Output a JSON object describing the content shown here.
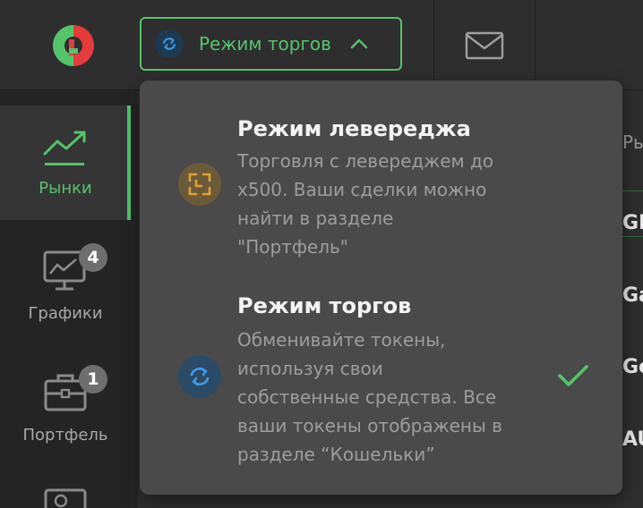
{
  "header": {
    "mode_button_label": "Режим торгов"
  },
  "sidebar": {
    "items": [
      {
        "label": "Рынки",
        "icon": "chart-trend-icon",
        "active": true
      },
      {
        "label": "Графики",
        "icon": "monitor-chart-icon",
        "badge": "4"
      },
      {
        "label": "Портфель",
        "icon": "briefcase-icon",
        "badge": "1"
      }
    ]
  },
  "background_list": {
    "header_fragment": "Ры",
    "rows": [
      "GI",
      "Ga",
      "Ge",
      "AU"
    ]
  },
  "dropdown": {
    "options": [
      {
        "title": "Режим левереджа",
        "description_lines": [
          "Торговля с левереджем до",
          "x500. Ваши сделки можно",
          "найти в разделе",
          "\"Портфель\""
        ],
        "icon": "leverage-frame-icon",
        "selected": false
      },
      {
        "title": "Режим торгов",
        "description_lines": [
          "Обменивайте токены,",
          "используя свои",
          "собственные средства. Все",
          "ваши токены отображены в",
          "разделе “Кошельки”"
        ],
        "icon": "swap-arrows-icon",
        "selected": true
      }
    ]
  },
  "colors": {
    "accent": "#56c46b",
    "background": "#2b2b2b",
    "dropdown_bg": "#4a4a4a",
    "leverage_icon": "#e0a232",
    "swap_icon": "#3d9be9"
  }
}
